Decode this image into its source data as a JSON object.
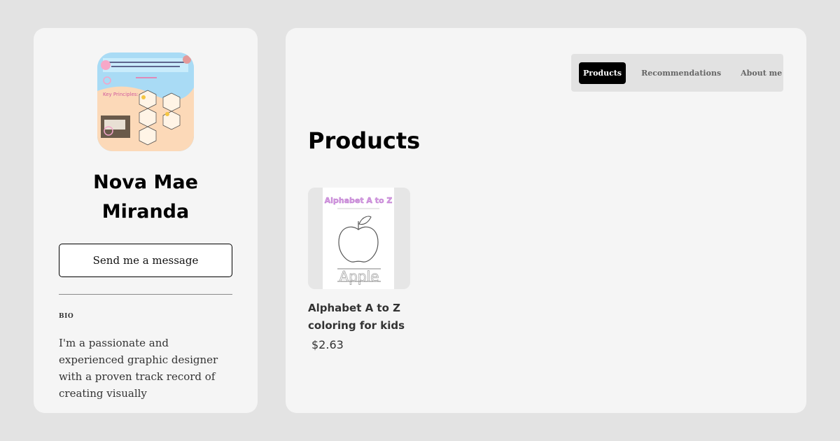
{
  "profile": {
    "name": "Nova Mae Miranda",
    "message_button": "Send me a message",
    "bio_label": "BIO",
    "bio_text": "I'm a passionate and experienced graphic designer with a proven track record of creating visually"
  },
  "nav": {
    "tabs": [
      {
        "label": "Products",
        "active": true
      },
      {
        "label": "Recommendations",
        "active": false
      },
      {
        "label": "About me",
        "active": false
      }
    ]
  },
  "main": {
    "section_title": "Products",
    "products": [
      {
        "title": "Alphabet A to Z coloring for kids",
        "price": "$2.63",
        "thumbnail": {
          "heading": "Alphabet A to Z",
          "word": "Apple"
        }
      }
    ]
  },
  "colors": {
    "page_bg": "#e3e3e3",
    "card_bg": "#f5f5f5",
    "active_tab_bg": "#000000",
    "tabs_bg": "#e2e2e2"
  }
}
